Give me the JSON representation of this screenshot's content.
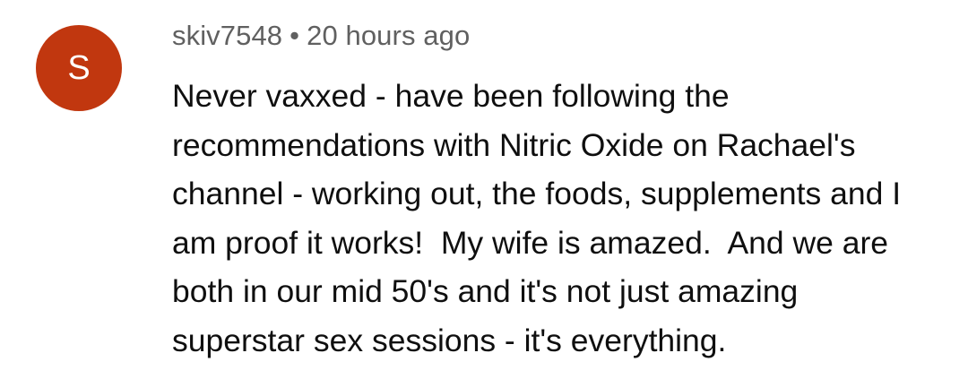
{
  "comment": {
    "avatar": {
      "initial": "S",
      "color": "#c1370f"
    },
    "author": "skiv7548",
    "separator": "•",
    "timestamp": "20 hours ago",
    "lines": [
      "Never vaxxed - have been following the",
      "recommendations with Nitric Oxide on Rachael's",
      "channel - working out, the foods, supplements and I",
      "am proof it works!  My wife is amazed.  And we are",
      "both in our mid 50's and it's not just amazing",
      "superstar sex sessions - it's everything."
    ]
  }
}
